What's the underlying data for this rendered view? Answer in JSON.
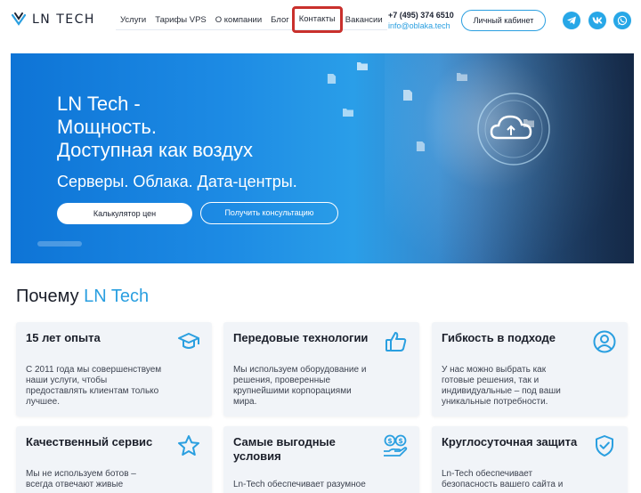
{
  "header": {
    "logo_text": "LN TECH",
    "nav": [
      "Услуги",
      "Тарифы VPS",
      "О компании",
      "Блог",
      "Контакты",
      "Вакансии"
    ],
    "phone": "+7 (495) 374 6510",
    "email": "info@oblaka.tech",
    "cabinet_label": "Личный кабинет",
    "social_icons": [
      "telegram-icon",
      "vk-icon",
      "whatsapp-icon"
    ]
  },
  "hero": {
    "title_lines": [
      "LN Tech -",
      "Мощность.",
      "Доступная как воздух"
    ],
    "subtitle": "Серверы. Облака. Дата-центры.",
    "btn_calc": "Калькулятор цен",
    "btn_consult": "Получить консультацию"
  },
  "why": {
    "title_prefix": "Почему",
    "title_accent": "LN Tech",
    "cards": [
      {
        "title": "15 лет опыта",
        "text": [
          "С 2011 года мы совершенствуем",
          "наши услуги, чтобы",
          "предоставлять клиентам только",
          "лучшее."
        ],
        "icon": "graduation-cap-icon"
      },
      {
        "title": "Передовые технологии",
        "text": [
          "Мы используем оборудование и",
          "решения, проверенные",
          "крупнейшими корпорациями",
          "мира."
        ],
        "icon": "thumbs-up-icon"
      },
      {
        "title": "Гибкость в подходе",
        "text": [
          "У нас можно выбрать как",
          "готовые решения, так и",
          "индивидуальные – под ваши",
          "уникальные потребности."
        ],
        "icon": "user-circle-icon"
      },
      {
        "title": "Качественный сервис",
        "text": [
          "Мы не используем ботов –",
          "всегда отвечают живые"
        ],
        "icon": "star-icon"
      },
      {
        "title_lines": [
          "Самые выгодные",
          "условия"
        ],
        "text": [
          "Ln-Tech обеспечивает разумное"
        ],
        "icon": "money-hand-icon"
      },
      {
        "title": "Круглосуточная защита",
        "text": [
          "Ln-Tech обеспечивает",
          "безопасность вашего сайта и"
        ],
        "icon": "shield-check-icon"
      }
    ]
  },
  "colors": {
    "accent": "#2a9fe0",
    "highlight": "#c9302c",
    "card_bg": "#f1f4f8"
  }
}
